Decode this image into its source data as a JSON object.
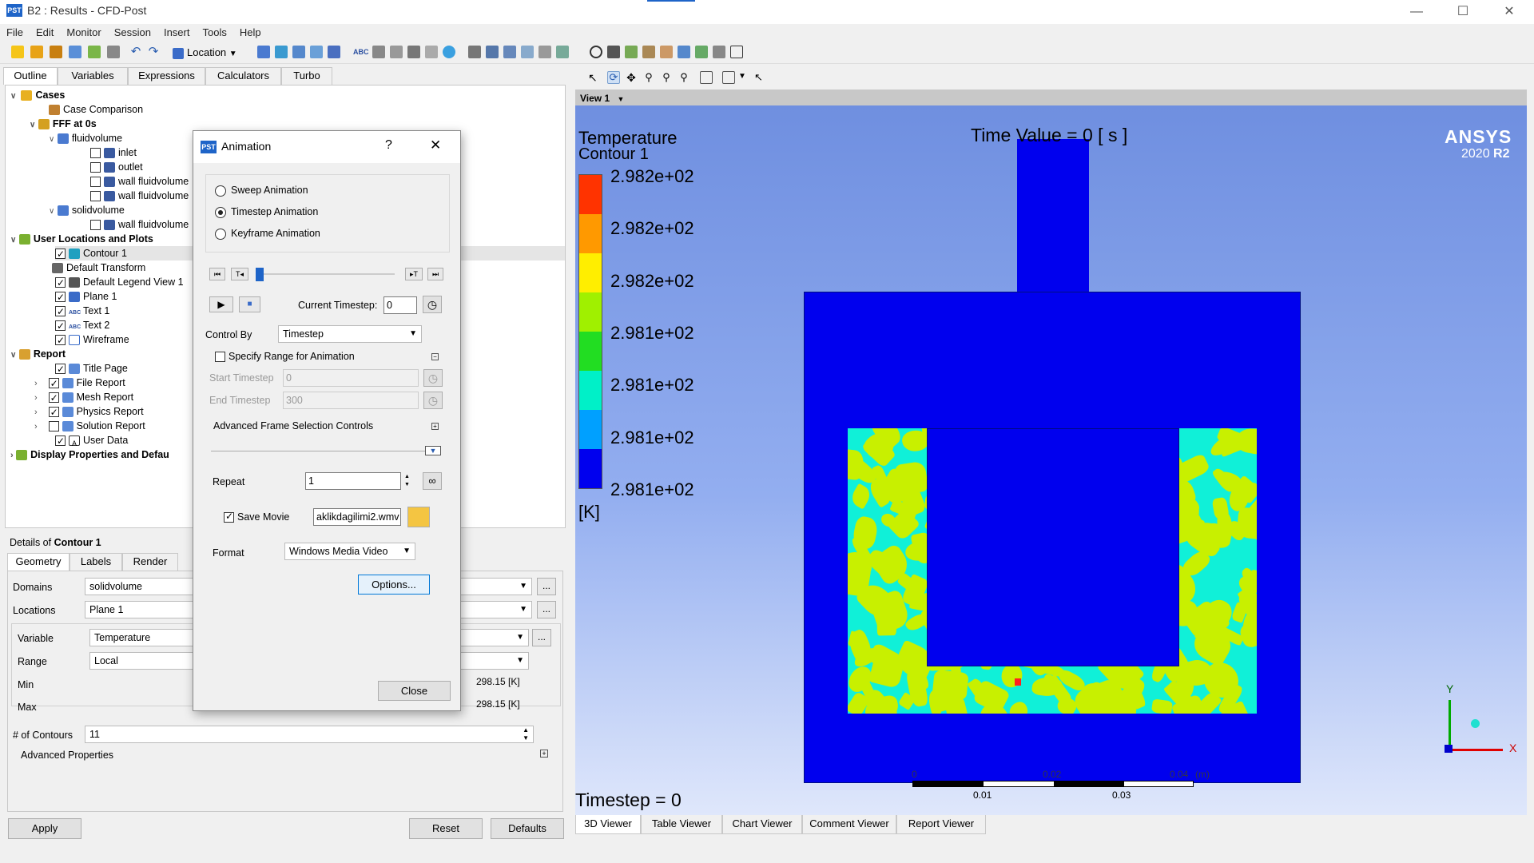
{
  "window": {
    "title": "B2 : Results - CFD-Post",
    "app_icon": "PST"
  },
  "menu": [
    "File",
    "Edit",
    "Monitor",
    "Session",
    "Insert",
    "Tools",
    "Help"
  ],
  "toolbar": {
    "location_label": "Location"
  },
  "left_tabs": [
    "Outline",
    "Variables",
    "Expressions",
    "Calculators",
    "Turbo"
  ],
  "tree": {
    "cases": "Cases",
    "case_comparison": "Case Comparison",
    "fff": "FFF at 0s",
    "fluidvolume": "fluidvolume",
    "inlet": "inlet",
    "outlet": "outlet",
    "wall1": "wall fluidvolume",
    "wall2": "wall fluidvolume",
    "solidvolume": "solidvolume",
    "wall3": "wall fluidvolume",
    "user_locations": "User Locations and Plots",
    "contour1": "Contour 1",
    "default_transform": "Default Transform",
    "legend": "Default Legend View 1",
    "plane1": "Plane 1",
    "text1": "Text 1",
    "text2": "Text 2",
    "wireframe": "Wireframe",
    "report": "Report",
    "title_page": "Title Page",
    "file_report": "File Report",
    "mesh_report": "Mesh Report",
    "physics_report": "Physics Report",
    "solution_report": "Solution Report",
    "user_data": "User Data",
    "display_props": "Display Properties and Defau"
  },
  "details": {
    "heading_prefix": "Details of ",
    "heading_object": "Contour 1",
    "tabs": [
      "Geometry",
      "Labels",
      "Render"
    ],
    "domains_label": "Domains",
    "domains_value": "solidvolume",
    "locations_label": "Locations",
    "locations_value": "Plane 1",
    "variable_label": "Variable",
    "variable_value": "Temperature",
    "range_label": "Range",
    "range_value": "Local",
    "min_label": "Min",
    "min_value": "298.15 [K]",
    "max_label": "Max",
    "max_value": "298.15 [K]",
    "contours_label": "# of Contours",
    "contours_value": "11",
    "advanced": "Advanced Properties",
    "apply": "Apply",
    "reset": "Reset",
    "defaults": "Defaults",
    "ellipsis": "..."
  },
  "dialog": {
    "title": "Animation",
    "help": "?",
    "close_x": "✕",
    "sweep": "Sweep Animation",
    "timestep": "Timestep Animation",
    "keyframe": "Keyframe Animation",
    "current_timestep_label": "Current Timestep:",
    "current_timestep_value": "0",
    "control_by_label": "Control By",
    "control_by_value": "Timestep",
    "specify_range": "Specify Range for Animation",
    "start_label": "Start Timestep",
    "start_value": "0",
    "end_label": "End Timestep",
    "end_value": "300",
    "advanced_frame": "Advanced Frame Selection Controls",
    "repeat_label": "Repeat",
    "repeat_value": "1",
    "save_movie": "Save Movie",
    "movie_file": "aklikdagilimi2.wmv",
    "format_label": "Format",
    "format_value": "Windows Media Video",
    "options": "Options...",
    "close": "Close",
    "first_frame": "⏮",
    "prev_keyframe": "T◂",
    "next_keyframe": "▸T",
    "last_frame": "⏭",
    "play": "▶",
    "stop": "■",
    "loop_icon": "∞",
    "slider_position": 0
  },
  "viewer": {
    "view_label": "View 1",
    "legend_title": "Temperature",
    "legend_subtitle": "Contour 1",
    "legend_values": [
      "2.982e+02",
      "2.982e+02",
      "2.982e+02",
      "2.981e+02",
      "2.981e+02",
      "2.981e+02",
      "2.981e+02"
    ],
    "legend_unit": "[K]",
    "time_value": "Time Value = 0 [ s ]",
    "ansys": "ANSYS",
    "version_prefix": "2020 ",
    "version_suffix": "R2",
    "timestep_text": "Timestep = 0",
    "scale_top": [
      "0",
      "0.02",
      "0.04",
      "(m)"
    ],
    "scale_bottom": [
      "0.01",
      "0.03"
    ],
    "axis_x": "X",
    "axis_y": "Y",
    "colors": {
      "red": "#ff3300",
      "orange": "#ff9900",
      "yellow": "#ffee00",
      "lime": "#a0f000",
      "green": "#22dd22",
      "cyan": "#00f0c8",
      "azure": "#00a0ff",
      "blue": "#0000ee",
      "mesh_lime": "#c8f000",
      "mesh_cyan": "#10f0d8"
    }
  },
  "bottom_tabs": [
    "3D Viewer",
    "Table Viewer",
    "Chart Viewer",
    "Comment Viewer",
    "Report Viewer"
  ]
}
